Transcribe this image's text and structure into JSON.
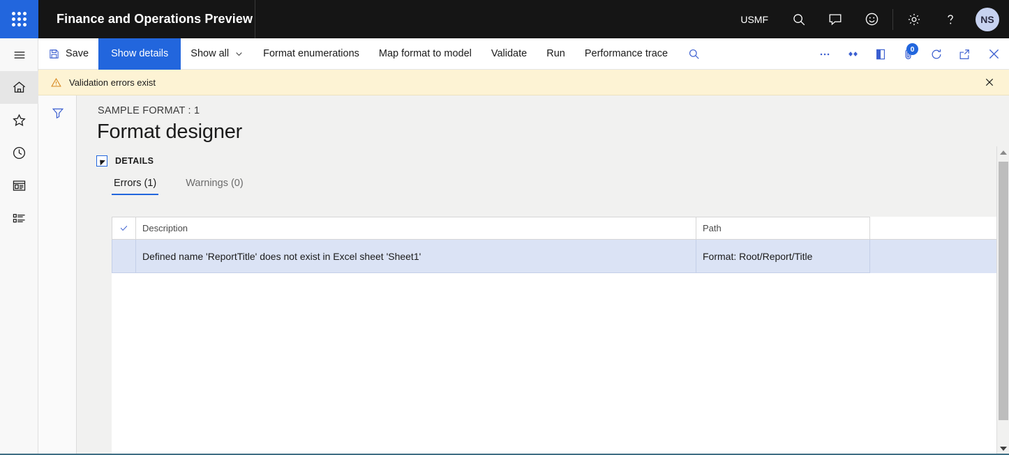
{
  "header": {
    "app_title": "Finance and Operations Preview",
    "company": "USMF",
    "waffle_icon": "app-launcher-icon",
    "icons": [
      {
        "name": "search-icon",
        "label": "Search"
      },
      {
        "name": "message-icon",
        "label": "Messages"
      },
      {
        "name": "feedback-smiley-icon",
        "label": "Feedback"
      },
      {
        "name": "gear-icon",
        "label": "Settings"
      },
      {
        "name": "help-question-icon",
        "label": "Help"
      }
    ],
    "avatar_initials": "NS"
  },
  "rail": {
    "items": [
      {
        "name": "hamburger-menu",
        "label": "Expand the navigation pane",
        "active": false
      },
      {
        "name": "home",
        "label": "Home",
        "active": true
      },
      {
        "name": "favorites-star",
        "label": "Favorites",
        "active": false
      },
      {
        "name": "recent-clock",
        "label": "Recent",
        "active": false
      },
      {
        "name": "workspaces",
        "label": "Workspaces",
        "active": false
      },
      {
        "name": "modules-list",
        "label": "Modules",
        "active": false
      }
    ]
  },
  "command_bar": {
    "save_label": "Save",
    "items": [
      {
        "label": "Show details",
        "primary": true
      },
      {
        "label": "Show all",
        "has_chevron": true
      },
      {
        "label": "Format enumerations",
        "has_chevron": false
      },
      {
        "label": "Map format to model",
        "has_chevron": false
      },
      {
        "label": "Validate",
        "has_chevron": false
      },
      {
        "label": "Run",
        "has_chevron": false
      },
      {
        "label": "Performance trace",
        "has_chevron": false
      }
    ],
    "search_icon": "search-icon",
    "right_icons": [
      {
        "name": "overflow-ellipsis-icon",
        "label": "More options"
      },
      {
        "name": "personalize-diamond-icon",
        "label": "Personalize"
      },
      {
        "name": "office-apps-icon",
        "label": "Open in Microsoft Office"
      },
      {
        "name": "attachment-paperclip-icon",
        "label": "Attachments",
        "badge": "0"
      },
      {
        "name": "refresh-icon",
        "label": "Refresh"
      },
      {
        "name": "open-in-new-window-icon",
        "label": "Open in new window"
      },
      {
        "name": "close-icon",
        "label": "Close"
      }
    ]
  },
  "message_bar": {
    "icon": "warning-triangle-icon",
    "text": "Validation errors exist",
    "close_icon": "close-icon"
  },
  "filter_pane": {
    "icon": "filter-funnel-icon",
    "label": "Show filters"
  },
  "page": {
    "caption": "SAMPLE FORMAT : 1",
    "title": "Format designer",
    "section_label": "DETAILS",
    "expander_icon": "collapse-caret-icon"
  },
  "tabs": [
    {
      "label": "Errors (1)",
      "active": true
    },
    {
      "label": "Warnings (0)",
      "active": false
    }
  ],
  "grid": {
    "select_all_icon": "checkmark-icon",
    "columns": [
      "Description",
      "Path"
    ],
    "rows": [
      {
        "description": "Defined name 'ReportTitle' does not exist in Excel sheet 'Sheet1'",
        "path": "Format: Root/Report/Title",
        "selected": true
      }
    ]
  },
  "scrollbar": {
    "up_icon": "scroll-up-arrow-icon",
    "down_icon": "scroll-down-arrow-icon"
  },
  "colors": {
    "brand_blue": "#2266dd",
    "header_black": "#151515",
    "warning_bg": "#fdf3d4",
    "row_selected": "#dbe3f5",
    "icon_blue": "#3b5fd0"
  }
}
